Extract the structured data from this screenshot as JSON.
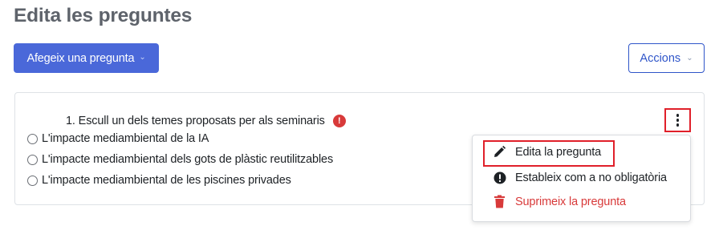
{
  "header": {
    "title": "Edita les preguntes"
  },
  "toolbar": {
    "add_label": "Afegeix una pregunta",
    "actions_label": "Accions"
  },
  "question": {
    "title": "1. Escull un dels temes proposats per als seminaris",
    "required_icon": "exclamation-circle-icon",
    "options": [
      {
        "label": "L'impacte mediambiental de la IA"
      },
      {
        "label": "L'impacte mediambiental dels gots de plàstic reutilitzables"
      },
      {
        "label": "L'impacte mediambiental de les piscines privades"
      }
    ]
  },
  "menu": {
    "items": [
      {
        "label": "Edita la pregunta",
        "icon": "pencil-icon"
      },
      {
        "label": "Estableix com a no obligatòria",
        "icon": "exclamation-circle-icon"
      },
      {
        "label": "Suprimeix la pregunta",
        "icon": "trash-icon"
      }
    ]
  },
  "colors": {
    "primary": "#4a68d9",
    "danger": "#d83a3a",
    "highlight": "#e0202a"
  }
}
